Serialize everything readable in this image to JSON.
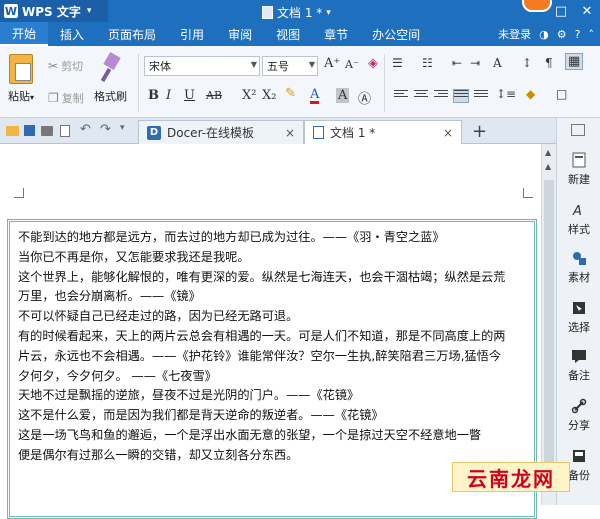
{
  "title_bar": {
    "app_name": "WPS 文字",
    "app_caret": "▾",
    "doc_title": "文档 1 *",
    "doc_caret": "▾",
    "logo_letter": "W",
    "window_controls": {
      "minimize": "—",
      "maximize": "□",
      "close": "✕"
    }
  },
  "menu": {
    "tabs": [
      "开始",
      "插入",
      "页面布局",
      "引用",
      "审阅",
      "视图",
      "章节",
      "办公空间"
    ],
    "active_tab": "开始",
    "login": "未登录"
  },
  "ribbon": {
    "paste_label": "粘贴",
    "paste_caret": "▾",
    "cut_label": "剪切",
    "copy_label": "复制",
    "format_painter_label": "格式刷",
    "font_name": "宋体",
    "font_size": "五号",
    "font_grow": "A⁺",
    "font_shrink": "A⁻",
    "bold": "B",
    "italic": "I",
    "underline": "U",
    "strikethrough": "AB",
    "superscript": "X²",
    "subscript": "X₂",
    "font_color": "A",
    "char_shading": "A"
  },
  "tabs": {
    "docer_label": "Docer-在线模板",
    "docer_icon": "D",
    "doc_label": "文档 1 *",
    "close": "×",
    "add": "+"
  },
  "document": {
    "lines": [
      "不能到达的地方都是远方，而去过的地方却已成为过往。——《羽・青空之蓝》",
      "当你已不再是你，又怎能要求我还是我呢。",
      "这个世界上，能够化解恨的，唯有更深的爱。纵然是七海连天，也会干涸枯竭；纵然是云荒",
      "万里，也会分崩离析。——《镜》",
      "不可以怀疑自己已经走过的路，因为已经无路可退。",
      "有的时候看起来，天上的两片云总会有相遇的一天。可是人们不知道，那是不同高度上的两",
      "片云，永远也不会相遇。——《护花铃》谁能常伴汝？空尔一生执,醉笑陪君三万场,猛悟今",
      "夕何夕，今夕何夕。 ——《七夜雪》",
      "天地不过是飘摇的逆旅，昼夜不过是光阴的门户。——《花镜》",
      "这不是什么爱，而是因为我们都是背天逆命的叛逆者。——《花镜》",
      "这是一场飞鸟和鱼的邂逅，一个是浮出水面无意的张望，一个是掠过天空不经意地一瞥",
      "便是偶尔有过那么一瞬的交错，却又立刻各分东西。"
    ]
  },
  "sidebar": {
    "items": [
      {
        "label": "新建",
        "icon": "new-icon"
      },
      {
        "label": "样式",
        "icon": "style-icon"
      },
      {
        "label": "素材",
        "icon": "material-icon"
      },
      {
        "label": "选择",
        "icon": "select-icon"
      },
      {
        "label": "备注",
        "icon": "note-icon"
      },
      {
        "label": "分享",
        "icon": "share-icon"
      },
      {
        "label": "备份",
        "icon": "backup-icon"
      }
    ]
  },
  "watermark": {
    "brand": "云南龙网"
  }
}
